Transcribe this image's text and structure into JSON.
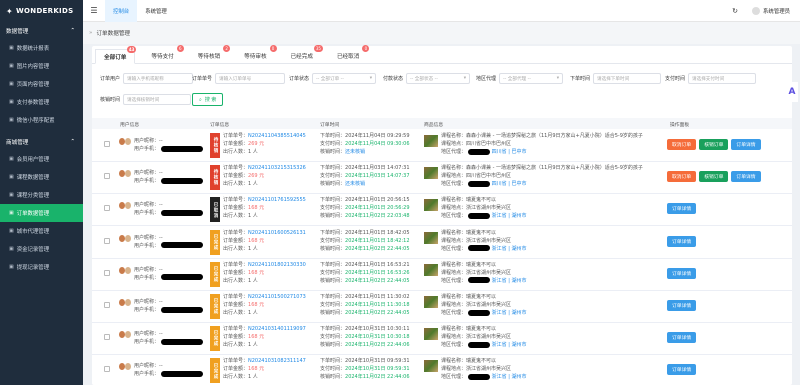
{
  "app": {
    "logo": "WONDERKIDS"
  },
  "sidebar": {
    "sections": [
      {
        "label": "数据管理"
      },
      {
        "label": "商城管理"
      }
    ],
    "items_a": [
      "数据统计报表",
      "图片内容管理",
      "页面内容管理",
      "支付参数管理",
      "微信小程序配置"
    ],
    "items_b": [
      "会员用户管理",
      "课程数据管理",
      "课程分类管理",
      "订单数据管理",
      "城市代理管理",
      "资金记录管理",
      "提现记录管理"
    ]
  },
  "topbar": {
    "tabs": [
      "控制台",
      "系统管理"
    ],
    "user": "系统管理员"
  },
  "breadcrumb": "订单数据管理",
  "tabs": [
    {
      "label": "全部订单",
      "badge": "43"
    },
    {
      "label": "等待支付",
      "badge": "6"
    },
    {
      "label": "等待核销",
      "badge": "2"
    },
    {
      "label": "等待审核",
      "badge": "0"
    },
    {
      "label": "已经完成",
      "badge": "35"
    },
    {
      "label": "已经取消",
      "badge": "0"
    }
  ],
  "filters": {
    "user": {
      "label": "订单用户",
      "ph": "请输入手机或昵称"
    },
    "orderno": {
      "label": "订单单号",
      "ph": "请输入订单单号"
    },
    "status": {
      "label": "订单状态",
      "ph": "-- 全部订单 --"
    },
    "pay": {
      "label": "付款状态",
      "ph": "-- 全部状态 --"
    },
    "agent": {
      "label": "地区代理",
      "ph": "-- 全部代理 --"
    },
    "ordertime": {
      "label": "下单时间",
      "ph": "请选择下单时间"
    },
    "paytime": {
      "label": "支付时间",
      "ph": "请选择支付时间"
    },
    "verify": {
      "label": "核销时间",
      "ph": "请选择核销时间"
    },
    "search": "搜 索"
  },
  "table": {
    "headers": [
      "用户信息",
      "订单信息",
      "订单时间",
      "商品信息",
      "操作面板"
    ]
  },
  "labels": {
    "nick": "用户昵称：",
    "phone": "用户手机：",
    "orderno": "订单单号：",
    "amount": "订单金额：",
    "people": "出行人数：",
    "ordert": "下单时间：",
    "payt": "支付时间：",
    "verifyt": "核销时间：",
    "course": "课程名称：",
    "loc": "课程地点：",
    "agent": "地区代理："
  },
  "orders": [
    {
      "nick": "--",
      "tag": "待核销",
      "tag_color": "#e0412d",
      "no": "N20241104385514045",
      "amount": "269 元",
      "people": "1 人",
      "t1": "2024年11月04日 09:29:59",
      "t2": "2024年11月04日 09:30:06",
      "t3": "还未核销",
      "course": "森森小课兼 - 一场追梦探秘之旅（11月9日方家山+凡夏小院）适合5-9岁的孩子",
      "loc": "四川省巴中市巴州区",
      "agent": "四川省 | 巴中市",
      "actions": [
        "取消订单",
        "核销订单",
        "订单详情"
      ]
    },
    {
      "nick": "--",
      "tag": "待核销",
      "tag_color": "#e0412d",
      "no": "N20241103215315326",
      "amount": "269 元",
      "people": "1 人",
      "t1": "2024年11月03日 14:07:31",
      "t2": "2024年11月03日 14:07:37",
      "t3": "还未核销",
      "course": "森森小课兼 - 一场追梦探秘之旅（11月9日方家山+凡夏小院）适合5-9岁的孩子",
      "loc": "四川省巴中市巴州区",
      "agent": "四川省 | 巴中市",
      "actions": [
        "取消订单",
        "核销订单",
        "订单详情"
      ]
    },
    {
      "nick": "--",
      "tag": "已取消",
      "tag_color": "#222222",
      "no": "N20241101761592555",
      "amount": "168 元",
      "people": "1 人",
      "t1": "2024年11月01日 20:56:15",
      "t2": "2024年11月01日 20:56:29",
      "t3": "2024年11月02日 22:03:48",
      "course": "瑞夏鬼不可以",
      "loc": "浙江省湖州市吴兴区",
      "agent": "浙江省 | 湖州市",
      "actions": [
        "订单详情"
      ]
    },
    {
      "nick": "--",
      "tag": "已完成",
      "tag_color": "#f0a020",
      "no": "N20241101600526131",
      "amount": "168 元",
      "people": "1 人",
      "t1": "2024年11月01日 18:42:05",
      "t2": "2024年11月01日 18:42:12",
      "t3": "2024年11月02日 22:44:05",
      "course": "瑞夏鬼不可以",
      "loc": "浙江省湖州市吴兴区",
      "agent": "浙江省 | 湖州市",
      "actions": [
        "订单详情"
      ]
    },
    {
      "nick": "--",
      "tag": "已完成",
      "tag_color": "#f0a020",
      "no": "N20241101802130330",
      "amount": "168 元",
      "people": "1 人",
      "t1": "2024年11月01日 16:53:21",
      "t2": "2024年11月01日 16:53:26",
      "t3": "2024年11月02日 22:44:05",
      "course": "瑞夏鬼不可以",
      "loc": "浙江省湖州市吴兴区",
      "agent": "浙江省 | 湖州市",
      "actions": [
        "订单详情"
      ]
    },
    {
      "nick": "--",
      "tag": "已完成",
      "tag_color": "#f0a020",
      "no": "N20241101500271073",
      "amount": "168 元",
      "people": "1 人",
      "t1": "2024年11月01日 11:30:02",
      "t2": "2024年11月01日 11:30:18",
      "t3": "2024年11月02日 22:44:05",
      "course": "瑞夏鬼不可以",
      "loc": "浙江省湖州市吴兴区",
      "agent": "浙江省 | 湖州市",
      "actions": [
        "订单详情"
      ]
    },
    {
      "nick": "--",
      "tag": "已完成",
      "tag_color": "#f0a020",
      "no": "N20241031401119097",
      "amount": "168 元",
      "people": "1 人",
      "t1": "2024年10月31日 10:30:11",
      "t2": "2024年10月31日 10:30:18",
      "t3": "2024年11月02日 22:44:06",
      "course": "瑞夏鬼不可以",
      "loc": "浙江省湖州市吴兴区",
      "agent": "浙江省 | 湖州市",
      "actions": [
        "订单详情"
      ]
    },
    {
      "nick": "--",
      "tag": "已完成",
      "tag_color": "#f0a020",
      "no": "N20241031082311147",
      "amount": "168 元",
      "people": "1 人",
      "t1": "2024年10月31日 09:59:31",
      "t2": "2024年10月31日 09:59:31",
      "t3": "2024年11月02日 22:44:06",
      "course": "瑞夏鬼不可以",
      "loc": "浙江省湖州市吴兴区",
      "agent": "浙江省 | 湖州市",
      "actions": [
        "订单详情"
      ]
    }
  ]
}
